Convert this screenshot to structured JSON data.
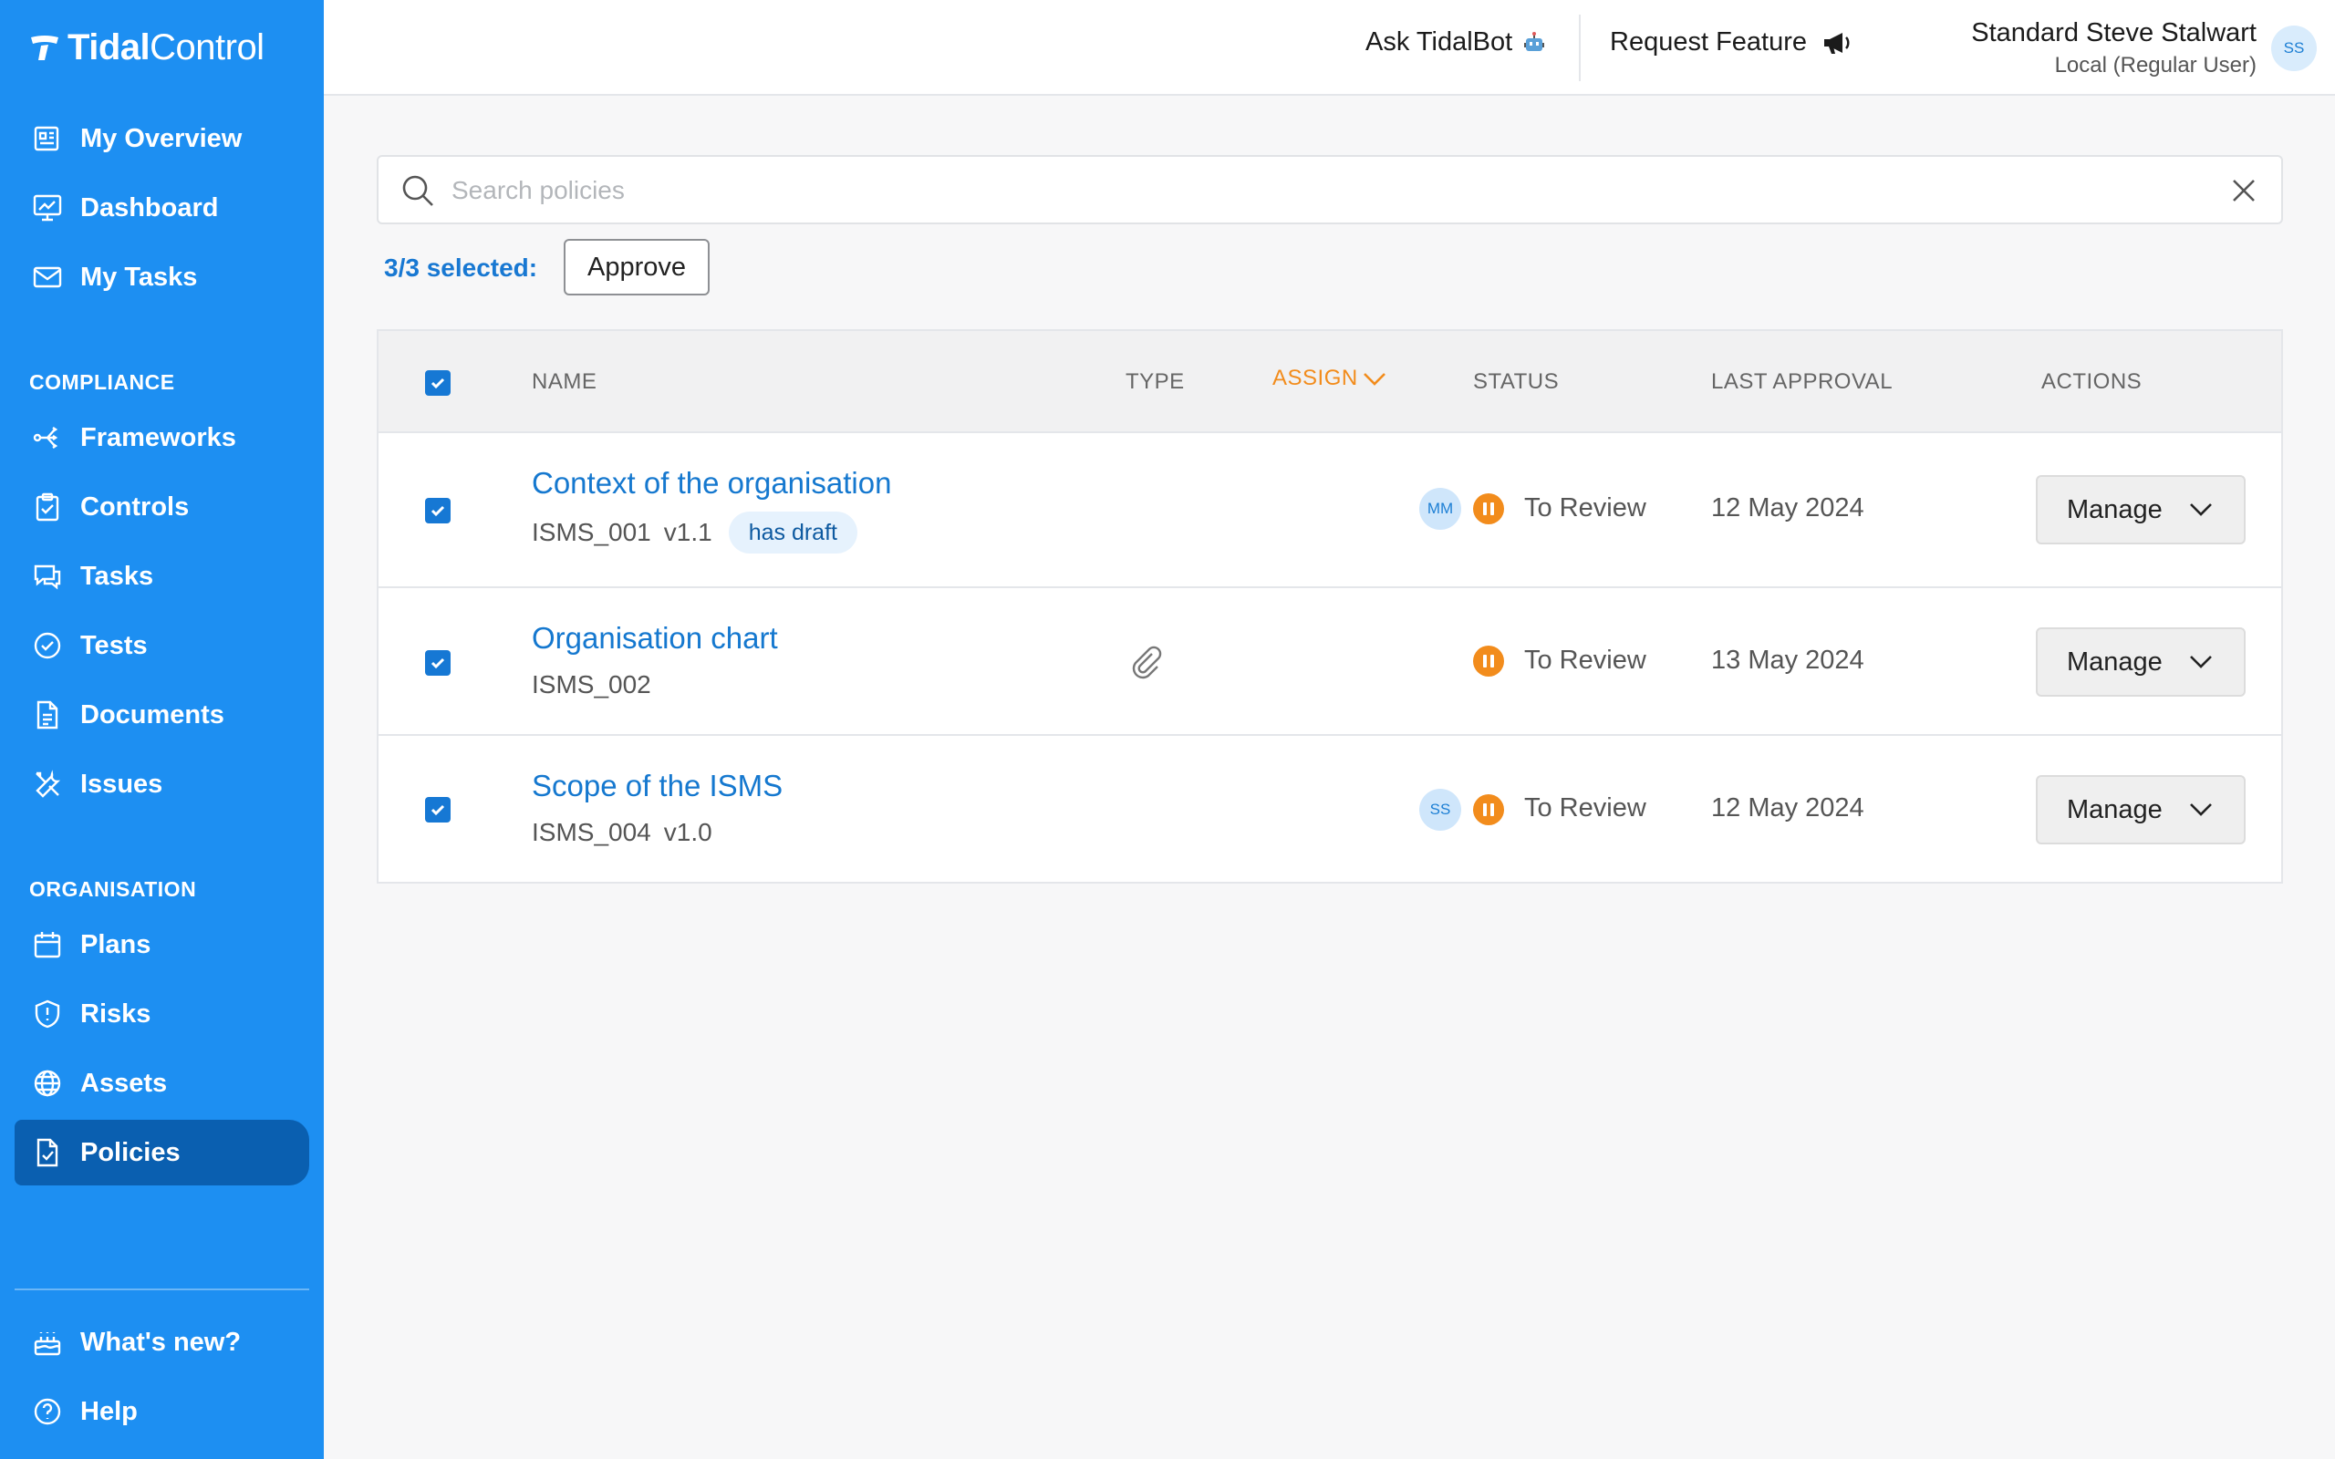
{
  "app": {
    "logo_bold": "Tidal",
    "logo_light": "Control"
  },
  "sidebar": {
    "items_top": [
      {
        "label": "My Overview",
        "icon": "overview-icon"
      },
      {
        "label": "Dashboard",
        "icon": "chart-icon"
      },
      {
        "label": "My Tasks",
        "icon": "mail-icon"
      }
    ],
    "compliance_label": "COMPLIANCE",
    "compliance_items": [
      {
        "label": "Frameworks",
        "icon": "frameworks-icon"
      },
      {
        "label": "Controls",
        "icon": "clipboard-check-icon"
      },
      {
        "label": "Tasks",
        "icon": "chat-icon"
      },
      {
        "label": "Tests",
        "icon": "check-circle-icon"
      },
      {
        "label": "Documents",
        "icon": "document-icon"
      },
      {
        "label": "Issues",
        "icon": "tools-icon"
      }
    ],
    "organisation_label": "ORGANISATION",
    "organisation_items": [
      {
        "label": "Plans",
        "icon": "calendar-icon"
      },
      {
        "label": "Risks",
        "icon": "shield-alert-icon"
      },
      {
        "label": "Assets",
        "icon": "globe-icon"
      },
      {
        "label": "Policies",
        "icon": "policy-icon",
        "active": true
      }
    ],
    "bottom_items": [
      {
        "label": "What's new?",
        "icon": "cake-icon"
      },
      {
        "label": "Help",
        "icon": "help-icon"
      }
    ]
  },
  "header": {
    "ask_bot": "Ask TidalBot",
    "request_feature": "Request Feature",
    "user_name": "Standard Steve Stalwart",
    "user_role": "Local (Regular User)",
    "user_initials": "SS"
  },
  "search": {
    "placeholder": "Search policies",
    "value": ""
  },
  "selection": {
    "label": "3/3 selected:",
    "approve_label": "Approve"
  },
  "table": {
    "columns": {
      "name": "NAME",
      "type": "TYPE",
      "assign": "ASSIGN",
      "status": "STATUS",
      "last_approval": "LAST APPROVAL",
      "actions": "ACTIONS"
    },
    "rows": [
      {
        "name": "Context of the organisation",
        "code": "ISMS_001",
        "version": "v1.1",
        "badge": "has draft",
        "assignee": "MM",
        "status": "To Review",
        "last_approval": "12 May 2024",
        "action": "Manage",
        "checked": true
      },
      {
        "name": "Organisation chart",
        "code": "ISMS_002",
        "version": "",
        "badge": "",
        "assignee": "",
        "type_icon": "paperclip-icon",
        "status": "To Review",
        "last_approval": "13 May 2024",
        "action": "Manage",
        "checked": true
      },
      {
        "name": "Scope of the ISMS",
        "code": "ISMS_004",
        "version": "v1.0",
        "badge": "",
        "assignee": "SS",
        "status": "To Review",
        "last_approval": "12 May 2024",
        "action": "Manage",
        "checked": true
      }
    ]
  },
  "colors": {
    "sidebar": "#1d8ff2",
    "sidebar_active": "#0a5fb0",
    "link": "#1578cf",
    "status_orange": "#f28c1c"
  }
}
